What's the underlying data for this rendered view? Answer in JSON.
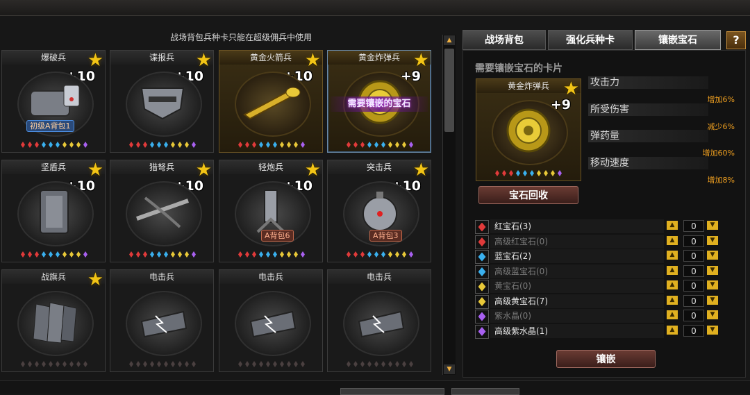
{
  "notice": "战场背包兵种卡只能在超级佣兵中使用",
  "cards": [
    {
      "name": "爆破兵",
      "level": "+10",
      "badge": "初级A背包1",
      "badge_style": "blue",
      "gems": [
        "red",
        "red",
        "red",
        "blue",
        "blue",
        "blue",
        "yel",
        "yel",
        "yel",
        "pur"
      ],
      "style": "normal",
      "tab": "gray",
      "star": "★",
      "art": "bomb"
    },
    {
      "name": "谍报兵",
      "level": "+10",
      "gems": [
        "red",
        "red",
        "red",
        "blue",
        "blue",
        "blue",
        "yel",
        "yel",
        "yel",
        "pur"
      ],
      "style": "normal",
      "tab": "gray",
      "star": "★",
      "art": "mask"
    },
    {
      "name": "黄金火箭兵",
      "level": "+10",
      "gems": [
        "red",
        "red",
        "red",
        "blue",
        "blue",
        "blue",
        "yel",
        "yel",
        "yel",
        "pur"
      ],
      "style": "gold",
      "tab": "gray",
      "star": "★",
      "art": "rocket"
    },
    {
      "name": "黄金炸弹兵",
      "level": "+9",
      "overlay": "需要镶嵌的宝石",
      "gems": [
        "red",
        "red",
        "red",
        "blue",
        "blue",
        "blue",
        "yel",
        "yel",
        "yel",
        "pur"
      ],
      "style": "gold selected",
      "tab": "gray",
      "star": "★",
      "art": "goldbomb"
    },
    {
      "name": "坚盾兵",
      "level": "+10",
      "gems": [
        "red",
        "red",
        "red",
        "blue",
        "blue",
        "blue",
        "yel",
        "yel",
        "yel",
        "pur"
      ],
      "style": "normal",
      "tab": "gray",
      "star": "★",
      "art": "shield"
    },
    {
      "name": "猎弩兵",
      "level": "+10",
      "gems": [
        "red",
        "red",
        "red",
        "blue",
        "blue",
        "blue",
        "yel",
        "yel",
        "yel",
        "pur"
      ],
      "style": "normal",
      "tab": "gray",
      "star": "★",
      "art": "crossbow"
    },
    {
      "name": "轻炮兵",
      "level": "+10",
      "badge": "A背包6",
      "badge_style": "red",
      "gems": [
        "red",
        "red",
        "red",
        "blue",
        "blue",
        "blue",
        "yel",
        "yel",
        "yel",
        "pur"
      ],
      "style": "normal",
      "tab": "gray",
      "star": "★",
      "art": "mortar"
    },
    {
      "name": "突击兵",
      "level": "+10",
      "badge": "A背包3",
      "badge_style": "red",
      "gems": [
        "red",
        "red",
        "red",
        "blue",
        "blue",
        "blue",
        "yel",
        "yel",
        "yel",
        "pur"
      ],
      "style": "normal",
      "tab": "gray",
      "star": "★",
      "art": "mine"
    },
    {
      "name": "战旗兵",
      "level": "",
      "gems": [
        "gray",
        "gray",
        "gray",
        "gray",
        "gray",
        "gray",
        "gray",
        "gray",
        "gray",
        "gray"
      ],
      "style": "normal",
      "tab": "green",
      "star": "★",
      "art": "flags"
    },
    {
      "name": "电击兵",
      "level": "",
      "gems": [
        "gray",
        "gray",
        "gray",
        "gray",
        "gray",
        "gray",
        "gray",
        "gray",
        "gray",
        "gray"
      ],
      "style": "normal",
      "tab": "green",
      "star": "",
      "art": "shock"
    },
    {
      "name": "电击兵",
      "level": "",
      "gems": [
        "gray",
        "gray",
        "gray",
        "gray",
        "gray",
        "gray",
        "gray",
        "gray",
        "gray",
        "gray"
      ],
      "style": "normal",
      "tab": "green",
      "star": "",
      "art": "shock"
    },
    {
      "name": "电击兵",
      "level": "",
      "gems": [
        "gray",
        "gray",
        "gray",
        "gray",
        "gray",
        "gray",
        "gray",
        "gray",
        "gray",
        "gray"
      ],
      "style": "normal",
      "tab": "green",
      "star": "",
      "art": "shock"
    }
  ],
  "tabs": {
    "backpack": "战场背包",
    "enhance": "强化兵种卡",
    "inlay": "镶嵌宝石",
    "help": "?"
  },
  "right": {
    "needs_title": "需要镶嵌宝石的卡片",
    "selected_card": {
      "name": "黄金炸弹兵",
      "level": "+9",
      "star": "★"
    },
    "stats": [
      {
        "label": "攻击力",
        "value": "增加6%"
      },
      {
        "label": "所受伤害",
        "value": "减少6%"
      },
      {
        "label": "弹药量",
        "value": "增加60%"
      },
      {
        "label": "移动速度",
        "value": "增加8%"
      }
    ],
    "recycle_button": "宝石回收",
    "inlay_button": "镶嵌",
    "gem_rows": [
      {
        "name": "红宝石(3)",
        "color": "red",
        "qty": "0",
        "active": true
      },
      {
        "name": "高级红宝石(0)",
        "color": "red",
        "qty": "0",
        "active": false
      },
      {
        "name": "蓝宝石(2)",
        "color": "blue",
        "qty": "0",
        "active": true
      },
      {
        "name": "高级蓝宝石(0)",
        "color": "blue",
        "qty": "0",
        "active": false
      },
      {
        "name": "黄宝石(0)",
        "color": "yel",
        "qty": "0",
        "active": false
      },
      {
        "name": "高级黄宝石(7)",
        "color": "yel",
        "qty": "0",
        "active": true
      },
      {
        "name": "紫水晶(0)",
        "color": "pur",
        "qty": "0",
        "active": false
      },
      {
        "name": "高级紫水晶(1)",
        "color": "pur",
        "qty": "0",
        "active": true
      }
    ]
  },
  "colors": {
    "red": "#e03a3a",
    "blue": "#3ab0ee",
    "yel": "#e8c838",
    "pur": "#a860f0",
    "gray": "#4a4040",
    "accent": "#f0a020"
  }
}
